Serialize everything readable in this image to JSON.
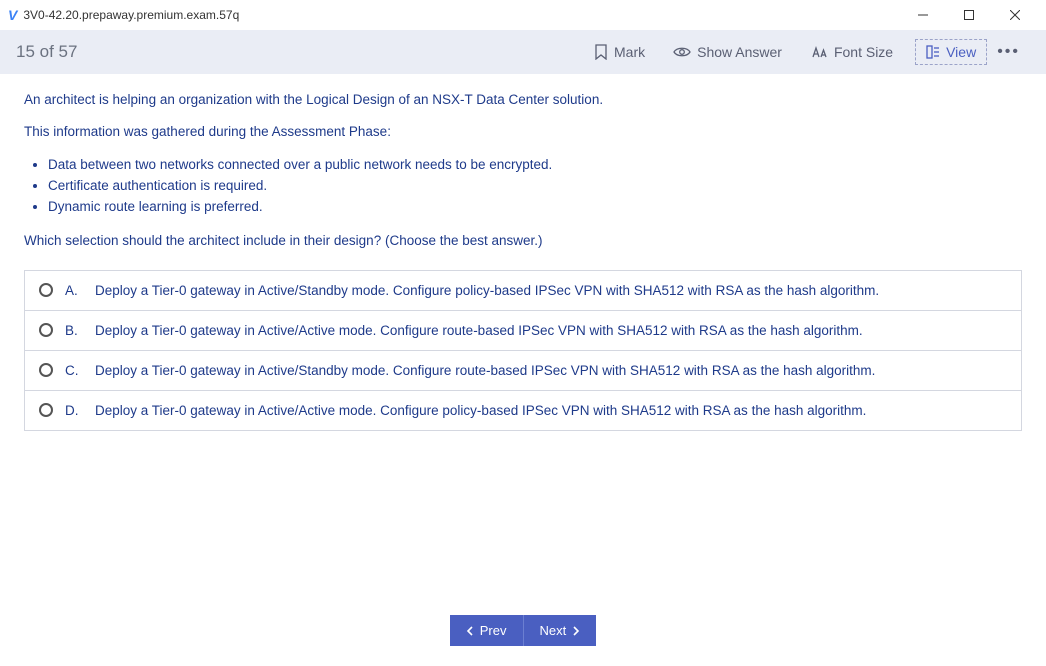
{
  "window": {
    "title": "3V0-42.20.prepaway.premium.exam.57q"
  },
  "toolbar": {
    "question_count": "15 of 57",
    "mark_label": "Mark",
    "show_answer_label": "Show Answer",
    "font_size_label": "Font Size",
    "view_label": "View"
  },
  "question": {
    "p1": "An architect is helping an organization with the Logical Design of an NSX-T Data Center solution.",
    "p2": "This information was gathered during the Assessment Phase:",
    "bullets": [
      "Data between two networks connected over a public network needs to be encrypted.",
      "Certificate authentication is required.",
      "Dynamic route learning is preferred."
    ],
    "p3": "Which selection should the architect include in their design? (Choose the best answer.)"
  },
  "answers": [
    {
      "letter": "A.",
      "text": "Deploy a Tier-0 gateway in Active/Standby mode. Configure policy-based IPSec VPN with SHA512 with RSA as the hash algorithm."
    },
    {
      "letter": "B.",
      "text": "Deploy a Tier-0 gateway in Active/Active mode. Configure route-based IPSec VPN with SHA512 with RSA as the hash algorithm."
    },
    {
      "letter": "C.",
      "text": "Deploy a Tier-0 gateway in Active/Standby mode. Configure route-based IPSec VPN with SHA512 with RSA as the hash algorithm."
    },
    {
      "letter": "D.",
      "text": "Deploy a Tier-0 gateway in Active/Active mode. Configure policy-based IPSec VPN with SHA512 with RSA as the hash algorithm."
    }
  ],
  "footer": {
    "prev_label": "Prev",
    "next_label": "Next"
  }
}
